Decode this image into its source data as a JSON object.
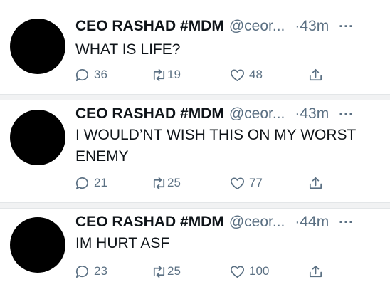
{
  "tweets": [
    {
      "author_name": "CEO RASHAD #MDM",
      "handle": "@ceor...",
      "time": "·43m",
      "more": "···",
      "text": "WHAT IS LIFE?",
      "replies": "36",
      "retweets": "19",
      "likes": "48"
    },
    {
      "author_name": "CEO RASHAD #MDM",
      "handle": "@ceor...",
      "time": "·43m",
      "more": "···",
      "text": "I WOULD’NT WISH THIS ON MY WORST ENEMY",
      "replies": "21",
      "retweets": "25",
      "likes": "77"
    },
    {
      "author_name": "CEO RASHAD #MDM",
      "handle": "@ceor...",
      "time": "·44m",
      "more": "···",
      "text": "IM HURT ASF",
      "replies": "23",
      "retweets": "25",
      "likes": "100"
    }
  ],
  "icons": {
    "reply": "reply-icon",
    "retweet": "retweet-icon",
    "like": "heart-icon",
    "share": "share-icon"
  },
  "colors": {
    "text": "#0f1419",
    "secondary": "#5b7083",
    "separator": "#f1f2f3"
  }
}
